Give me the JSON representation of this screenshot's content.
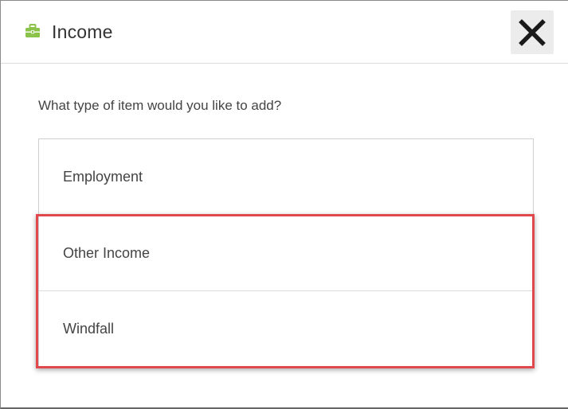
{
  "dialog": {
    "title": "Income",
    "title_icon": "briefcase-icon",
    "close_icon": "close-icon",
    "icon_color": "#8bc34a"
  },
  "prompt": {
    "question": "What type of item would you like to add?"
  },
  "options": [
    {
      "label": "Employment"
    },
    {
      "label": "Other Income"
    },
    {
      "label": "Windfall"
    }
  ],
  "annotation": {
    "highlight_color": "#e0484e"
  }
}
